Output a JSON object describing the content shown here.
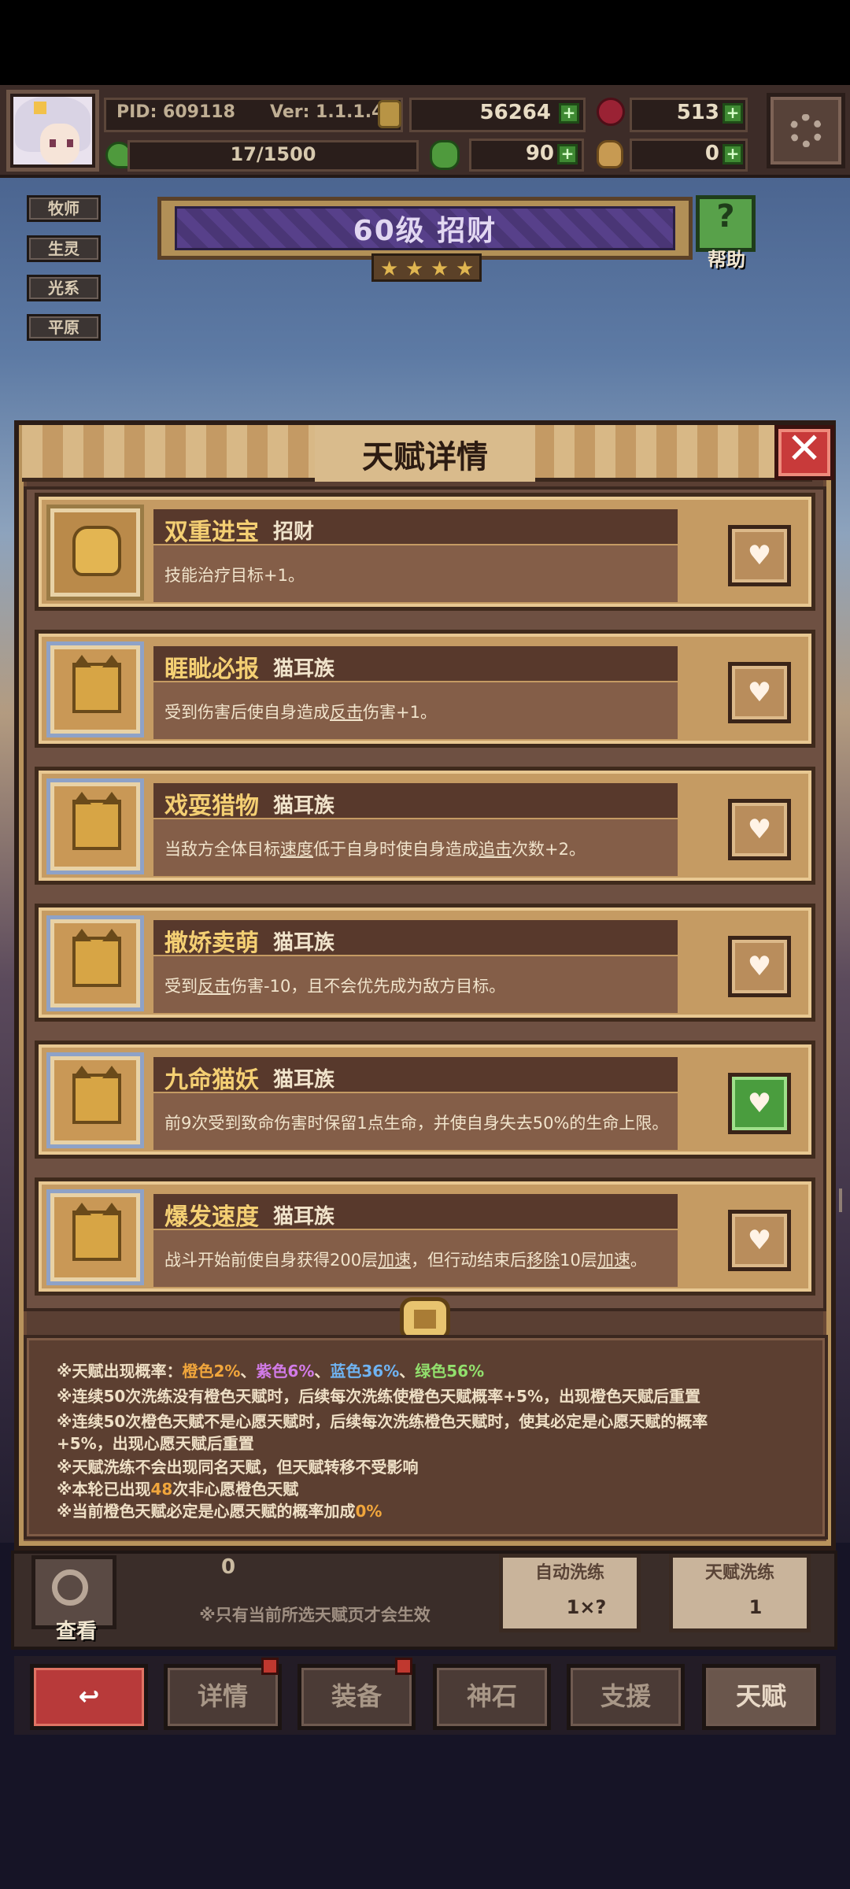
{
  "topbar": {
    "pid": "PID: 609118",
    "version": "Ver: 1.1.1.4",
    "gold": "56264",
    "gems": "513",
    "stamina": "17/1500",
    "clovers": "90",
    "sacks": "0"
  },
  "side_tags": [
    "牧师",
    "生灵",
    "光系",
    "平原"
  ],
  "level_banner": {
    "text": "60级 招财",
    "stars": 4,
    "help_label": "帮助"
  },
  "dialog": {
    "title": "天赋详情",
    "close_icon": "close-icon"
  },
  "talents": [
    {
      "name": "双重进宝",
      "type": "招财",
      "desc_parts": [
        [
          "技能治疗目标+1。",
          false
        ]
      ],
      "icon": "star-icon",
      "favorited": false
    },
    {
      "name": "睚眦必报",
      "type": "猫耳族",
      "desc_parts": [
        [
          "受到伤害后使自身造成",
          false
        ],
        [
          "反击",
          true
        ],
        [
          "伤害+1。",
          false
        ]
      ],
      "icon": "cat-icon",
      "favorited": false
    },
    {
      "name": "戏耍猎物",
      "type": "猫耳族",
      "desc_parts": [
        [
          "当敌方全体目标",
          false
        ],
        [
          "速度",
          true
        ],
        [
          "低于自身时使自身造成",
          false
        ],
        [
          "追击",
          true
        ],
        [
          "次数+2。",
          false
        ]
      ],
      "icon": "cat-icon",
      "favorited": false
    },
    {
      "name": "撒娇卖萌",
      "type": "猫耳族",
      "desc_parts": [
        [
          "受到",
          false
        ],
        [
          "反击",
          true
        ],
        [
          "伤害-10，且不会优先成为敌方目标。",
          false
        ]
      ],
      "icon": "cat-icon",
      "favorited": false
    },
    {
      "name": "九命猫妖",
      "type": "猫耳族",
      "desc_parts": [
        [
          "前9次受到致命伤害时保留1点生命，并使自身失去50%的生命上限。",
          false
        ]
      ],
      "icon": "cat-icon",
      "favorited": true
    },
    {
      "name": "爆发速度",
      "type": "猫耳族",
      "desc_parts": [
        [
          "战斗开始前使自身获得200层",
          false
        ],
        [
          "加速",
          true
        ],
        [
          "，但行动结束后",
          false
        ],
        [
          "移除",
          true
        ],
        [
          "10层",
          false
        ],
        [
          "加速",
          true
        ],
        [
          "。",
          false
        ]
      ],
      "icon": "cat-icon",
      "favorited": false
    }
  ],
  "info": {
    "prob_prefix": "※天赋出现概率：",
    "prob_orange": "橙色2%",
    "prob_purple": "紫色6%",
    "prob_blue": "蓝色36%",
    "prob_green": "绿色56%",
    "sep": "、",
    "line2": "※连续50次洗练没有橙色天赋时，后续每次洗练使橙色天赋概率+5%，出现橙色天赋后重置",
    "line3": "※连续50次橙色天赋不是心愿天赋时，后续每次洗练橙色天赋时，使其必定是心愿天赋的概率",
    "line4": "+5%，出现心愿天赋后重置",
    "line5": "※天赋洗练不会出现同名天赋，但天赋转移不受影响",
    "line6_pre": "※本轮已出现",
    "line6_num": "48",
    "line6_post": "次非心愿橙色天赋",
    "line7_pre": "※当前橙色天赋必定是心愿天赋的概率加成",
    "line7_num": "0%"
  },
  "lower": {
    "view_label": "查看",
    "count": "0",
    "note": "※只有当前所选天赋页才会生效",
    "auto_label": "自动洗练",
    "auto_value": "1×?",
    "wash_label": "天赋洗练",
    "wash_value": "1"
  },
  "nav": {
    "back": "↩",
    "detail": "详情",
    "equip": "装备",
    "stone": "神石",
    "support": "支援",
    "talent": "天赋"
  },
  "colors": {
    "orange": "#f1a63c",
    "purple": "#d27be8",
    "blue": "#6fb3f2",
    "green": "#92e06d",
    "favorite_active": "#4a9d3e"
  }
}
